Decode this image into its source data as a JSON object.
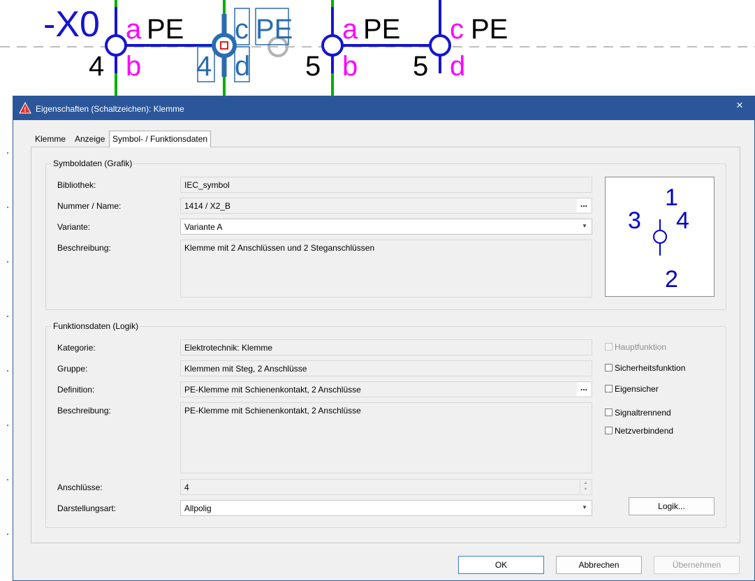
{
  "schematic": {
    "terminal_strip_label": "-X0",
    "numbers": [
      "4",
      "4",
      "5",
      "5"
    ],
    "letters": [
      "a",
      "b",
      "c",
      "d",
      "a",
      "b",
      "c",
      "d"
    ],
    "pe_labels": [
      "PE",
      "PE",
      "PE",
      "PE"
    ]
  },
  "dialog": {
    "title": "Eigenschaften (Schaltzeichen): Klemme",
    "close_glyph": "×",
    "tabs": [
      {
        "label": "Klemme"
      },
      {
        "label": "Anzeige"
      },
      {
        "label": "Symbol- / Funktionsdaten",
        "active": true
      }
    ],
    "symbol_group": {
      "title": "Symboldaten (Grafik)",
      "library_label": "Bibliothek:",
      "library_value": "IEC_symbol",
      "number_label": "Nummer / Name:",
      "number_value": "1414 / X2_B",
      "variant_label": "Variante:",
      "variant_value": "Variante A",
      "description_label": "Beschreibung:",
      "description_value": "Klemme mit 2 Anschlüssen und 2 Steganschlüssen",
      "preview": {
        "pin_labels": [
          "1",
          "2",
          "3",
          "4"
        ],
        "color": "#0000cc"
      }
    },
    "function_group": {
      "title": "Funktionsdaten (Logik)",
      "category_label": "Kategorie:",
      "category_value": "Elektrotechnik: Klemme",
      "group_label": "Gruppe:",
      "group_value": "Klemmen mit Steg, 2 Anschlüsse",
      "definition_label": "Definition:",
      "definition_value": "PE-Klemme mit Schienenkontakt, 2 Anschlüsse",
      "description_label": "Beschreibung:",
      "description_value": "PE-Klemme mit Schienenkontakt, 2 Anschlüsse",
      "connections_label": "Anschlüsse:",
      "connections_value": "4",
      "representation_label": "Darstellungsart:",
      "representation_value": "Allpolig",
      "checkboxes": [
        {
          "label": "Hauptfunktion",
          "checked": false,
          "enabled": false
        },
        {
          "label": "Sicherheitsfunktion",
          "checked": false,
          "enabled": true
        },
        {
          "label": "Eigensicher",
          "checked": false,
          "enabled": true
        },
        {
          "label": "Signaltrennend",
          "checked": false,
          "enabled": true
        },
        {
          "label": "Netzverbindend",
          "checked": false,
          "enabled": true
        }
      ],
      "logic_button": "Logik..."
    },
    "ellipsis": "...",
    "buttons": {
      "ok": "OK",
      "cancel": "Abbrechen",
      "apply": "Übernehmen"
    }
  },
  "colors": {
    "titlebar": "#2b579a",
    "schematic_blue": "#1515d0",
    "schematic_magenta": "#ff00ff",
    "schematic_green": "#00b000",
    "selection_blue": "#2a6cb0"
  }
}
